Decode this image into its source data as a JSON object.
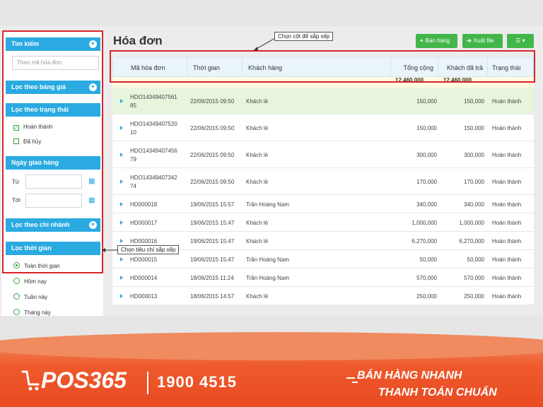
{
  "page": {
    "title": "Hóa đơn"
  },
  "toolbar": {
    "sell_label": "Bán hàng",
    "export_label": "Xuất file",
    "accent": "#43b649"
  },
  "sidebar": {
    "search_header": "Tìm kiếm",
    "search_placeholder": "Theo mã hóa đơn",
    "price_filter_header": "Lọc theo bảng giá",
    "status_filter_header": "Lọc theo trạng thái",
    "status_options": [
      "Hoàn thành",
      "Đã hủy"
    ],
    "delivery_header": "Ngày giao hàng",
    "from_label": "Từ",
    "to_label": "Tới",
    "branch_filter_header": "Lọc theo chi nhánh",
    "time_filter_header": "Lọc thời gian",
    "time_options": [
      "Toàn thời gian",
      "Hôm nay",
      "Tuần này",
      "Tháng này"
    ],
    "header_color": "#2aaae1"
  },
  "table": {
    "columns": [
      "Mã hóa đơn",
      "Thời gian",
      "Khách hàng",
      "Tổng cộng",
      "Khách đã trả",
      "Trạng thái"
    ],
    "totals": {
      "total": "12,460,000",
      "paid": "12,460,000"
    },
    "rows": [
      {
        "code": "HDO14349407561",
        "code2": "85",
        "time": "22/06/2015 09:50",
        "customer": "Khách lẻ",
        "total": "150,000",
        "paid": "150,000",
        "status": "Hoàn thành"
      },
      {
        "code": "HDO14349407520",
        "code2": "10",
        "time": "22/06/2015 09:50",
        "customer": "Khách lẻ",
        "total": "150,000",
        "paid": "150,000",
        "status": "Hoàn thành"
      },
      {
        "code": "HDO14349407456",
        "code2": "79",
        "time": "22/06/2015 09:50",
        "customer": "Khách lẻ",
        "total": "300,000",
        "paid": "300,000",
        "status": "Hoàn thành"
      },
      {
        "code": "HDO14349407342",
        "code2": "74",
        "time": "22/06/2015 09:50",
        "customer": "Khách lẻ",
        "total": "170,000",
        "paid": "170,000",
        "status": "Hoàn thành"
      },
      {
        "code": "HD000018",
        "code2": "",
        "time": "19/06/2015 15:57",
        "customer": "Trần Hoàng Nam",
        "total": "340,000",
        "paid": "340,000",
        "status": "Hoàn thành"
      },
      {
        "code": "HD000017",
        "code2": "",
        "time": "19/06/2015 15:47",
        "customer": "Khách lẻ",
        "total": "1,000,000",
        "paid": "1,000,000",
        "status": "Hoàn thành"
      },
      {
        "code": "HD000016",
        "code2": "",
        "time": "19/06/2015 15:47",
        "customer": "Khách lẻ",
        "total": "6,270,000",
        "paid": "6,270,000",
        "status": "Hoàn thành"
      },
      {
        "code": "HD000015",
        "code2": "",
        "time": "19/06/2015 15:47",
        "customer": "Trần Hoàng Nam",
        "total": "50,000",
        "paid": "50,000",
        "status": "Hoàn thành"
      },
      {
        "code": "HD000014",
        "code2": "",
        "time": "18/06/2015 11:24",
        "customer": "Trần Hoàng Nam",
        "total": "570,000",
        "paid": "570,000",
        "status": "Hoàn thành"
      },
      {
        "code": "HD000013",
        "code2": "",
        "time": "18/06/2015 14:57",
        "customer": "Khách lẻ",
        "total": "250,000",
        "paid": "250,000",
        "status": "Hoàn thành"
      }
    ]
  },
  "callouts": {
    "columns": "Chọn cột để sắp xếp",
    "criteria": "Chọn tiêu chí sắp xếp"
  },
  "footer": {
    "brand": "POS365",
    "hotline": "1900 4515",
    "slogan_line1": "BÁN HÀNG NHANH",
    "slogan_line2": "THANH TOÁN CHUẨN"
  }
}
